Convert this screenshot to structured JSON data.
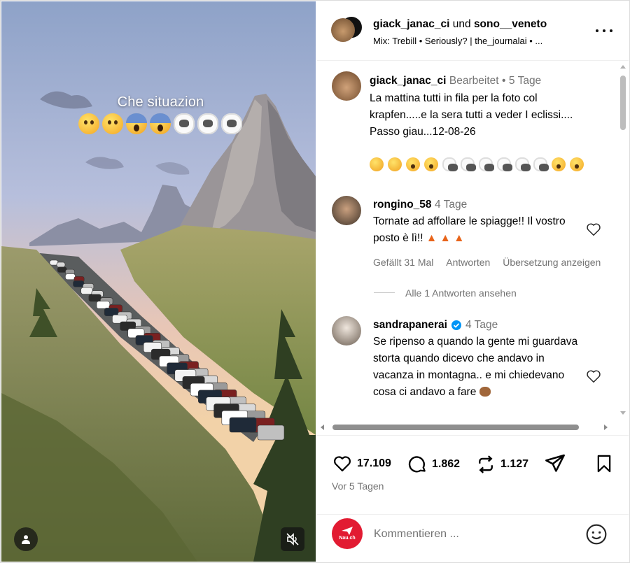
{
  "media": {
    "overlay_text": "Che situazion",
    "emojis": [
      "face-icon",
      "face-icon",
      "scream-icon",
      "scream-icon",
      "sheep-icon",
      "sheep-icon",
      "sheep-icon"
    ]
  },
  "header": {
    "user1": "giack_janac_ci",
    "connector": " und ",
    "user2": "sono__veneto",
    "subtitle": "Mix: Trebill • Seriously? | the_journalai • ..."
  },
  "caption": {
    "author": "giack_janac_ci",
    "edited": "Bearbeitet",
    "dot": "•",
    "time": "5 Tage",
    "text": "La mattina tutti in fila per la foto col krapfen.....e la sera  tutti a veder I eclissi.... Passo giau...12-08-26"
  },
  "comments": [
    {
      "author": "rongino_58",
      "time": "4 Tage",
      "text": "Tornate ad affollare le spiagge!! Il vostro posto è lì!!",
      "likes": "Gefällt 31 Mal",
      "reply": "Antworten",
      "translate": "Übersetzung anzeigen",
      "view_replies": "Alle 1 Antworten ansehen"
    },
    {
      "author": "sandrapanerai",
      "time": "4 Tage",
      "text": "Se ripenso a quando la gente mi guardava storta quando dicevo che andavo in vacanza in montagna.. e mi chiedevano cosa ci andavo a fare"
    }
  ],
  "stats": {
    "likes": "17.109",
    "comments": "1.862",
    "reposts": "1.127",
    "posted": "Vor 5 Tagen"
  },
  "composer": {
    "placeholder": "Kommentieren ...",
    "logo_text": "Nau.ch"
  },
  "colors": {
    "brand_red": "#e21b32",
    "verified_blue": "#0095f6",
    "meta_gray": "#737373"
  }
}
